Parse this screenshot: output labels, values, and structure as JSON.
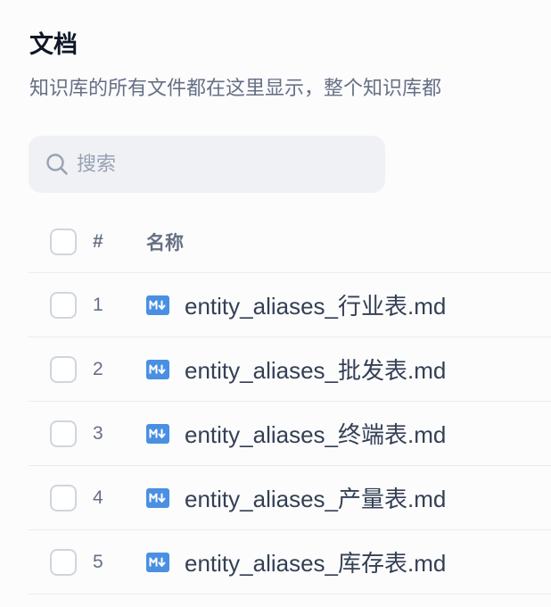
{
  "header": {
    "title": "文档",
    "subtitle": "知识库的所有文件都在这里显示，整个知识库都"
  },
  "search": {
    "placeholder": "搜索",
    "value": ""
  },
  "table": {
    "columns": {
      "index": "#",
      "name": "名称"
    },
    "rows": [
      {
        "index": "1",
        "name": "entity_aliases_行业表.md"
      },
      {
        "index": "2",
        "name": "entity_aliases_批发表.md"
      },
      {
        "index": "3",
        "name": "entity_aliases_终端表.md"
      },
      {
        "index": "4",
        "name": "entity_aliases_产量表.md"
      },
      {
        "index": "5",
        "name": "entity_aliases_库存表.md"
      }
    ]
  },
  "icons": {
    "search": "search-icon",
    "file": "markdown-file-icon"
  },
  "colors": {
    "markdown_icon": "#4a90e2",
    "search_bg": "#eff1f5"
  }
}
